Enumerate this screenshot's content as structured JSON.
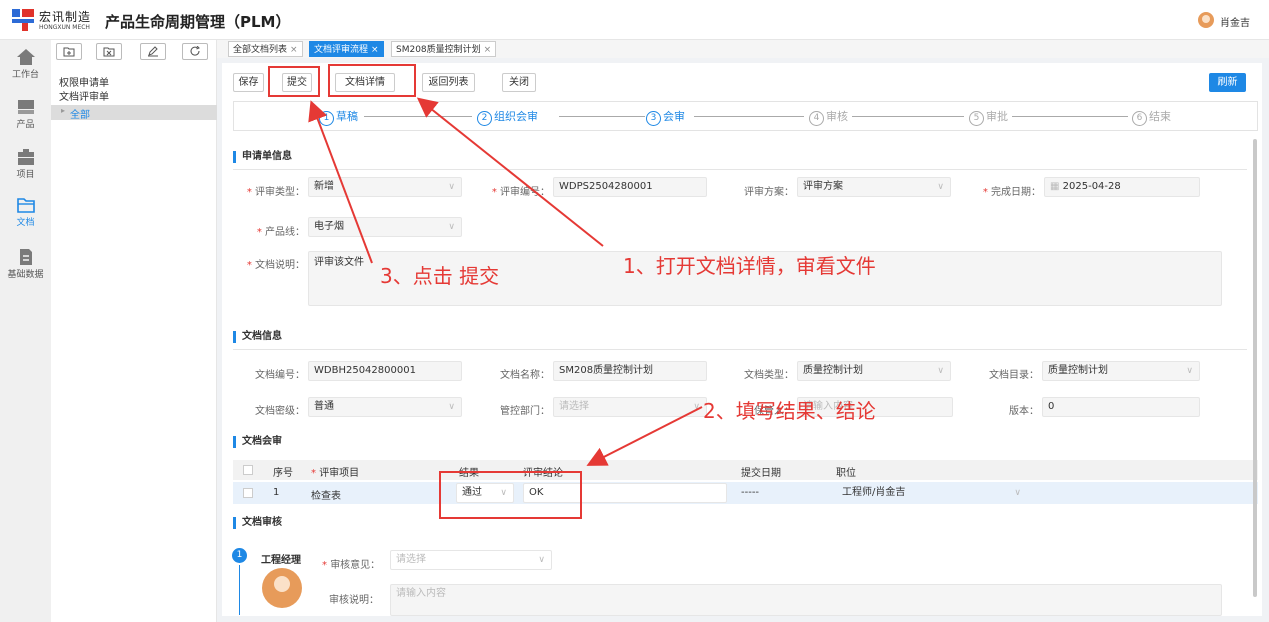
{
  "header": {
    "brand_cn": "宏讯制造",
    "brand_en": "HONGXUN MECH",
    "app_title": "产品生命周期管理（PLM）",
    "user_name": "肖金吉"
  },
  "nav": [
    {
      "label": "工作台",
      "icon": "home-icon"
    },
    {
      "label": "产品",
      "icon": "product-icon"
    },
    {
      "label": "项目",
      "icon": "project-icon"
    },
    {
      "label": "文档",
      "icon": "folder-icon",
      "active": true
    },
    {
      "label": "基础数据",
      "icon": "document-icon"
    }
  ],
  "tree": {
    "items": [
      "权限申请单",
      "文档评审单"
    ],
    "selected": "全部"
  },
  "tabs": [
    {
      "label": "全部文档列表"
    },
    {
      "label": "文档评审流程",
      "active": true
    },
    {
      "label": "SM208质量控制计划"
    }
  ],
  "toolbar": {
    "save": "保存",
    "submit": "提交",
    "doc_detail": "文档详情",
    "back_list": "返回列表",
    "close": "关闭",
    "refresh": "刷新"
  },
  "steps": [
    {
      "num": "1",
      "label": "草稿",
      "done": true
    },
    {
      "num": "2",
      "label": "组织会审",
      "done": true
    },
    {
      "num": "3",
      "label": "会审",
      "done": true
    },
    {
      "num": "4",
      "label": "审核"
    },
    {
      "num": "5",
      "label": "审批"
    },
    {
      "num": "6",
      "label": "结束"
    }
  ],
  "request_info": {
    "title": "申请单信息",
    "review_type_label": "评审类型：",
    "review_type": "新增",
    "review_no_label": "评审编号：",
    "review_no": "WDPS2504280001",
    "review_plan_label": "评审方案：",
    "review_plan": "评审方案",
    "finish_date_label": "完成日期：",
    "finish_date": "2025-04-28",
    "product_line_label": "产品线：",
    "product_line": "电子烟",
    "doc_desc_label": "文档说明：",
    "doc_desc": "评审该文件"
  },
  "doc_info": {
    "title": "文档信息",
    "doc_no_label": "文档编号：",
    "doc_no": "WDBH25042800001",
    "doc_name_label": "文档名称：",
    "doc_name": "SM208质量控制计划",
    "doc_type_label": "文档类型：",
    "doc_type": "质量控制计划",
    "doc_dir_label": "文档目录：",
    "doc_dir": "质量控制计划",
    "secret_label": "文档密级：",
    "secret": "普通",
    "dept_label": "管控部门：",
    "dept_placeholder": "请选择",
    "keeper_label": "保管人：",
    "keeper_placeholder": "请输入内容",
    "version_label": "版本：",
    "version": "0"
  },
  "review_table": {
    "title": "文档会审",
    "headers": [
      "序号",
      "评审项目",
      "结果",
      "评审结论",
      "提交日期",
      "职位"
    ],
    "rows": [
      {
        "no": "1",
        "item": "检查表",
        "result": "通过",
        "conclusion": "OK",
        "date": "-----",
        "position": "工程师/肖金吉"
      }
    ]
  },
  "audit": {
    "title": "文档审核",
    "step_no": "1",
    "role": "工程经理",
    "opinion_label": "审核意见：",
    "opinion_placeholder": "请选择",
    "note_label": "审核说明：",
    "note_placeholder": "请输入内容"
  },
  "annotations": {
    "a1": "1、打开文档详情，审看文件",
    "a2": "2、填写结果、结论",
    "a3": "3、点击 提交"
  },
  "colors": {
    "accent": "#1e88e5",
    "annotation": "#e53935",
    "required": "#e53935"
  }
}
